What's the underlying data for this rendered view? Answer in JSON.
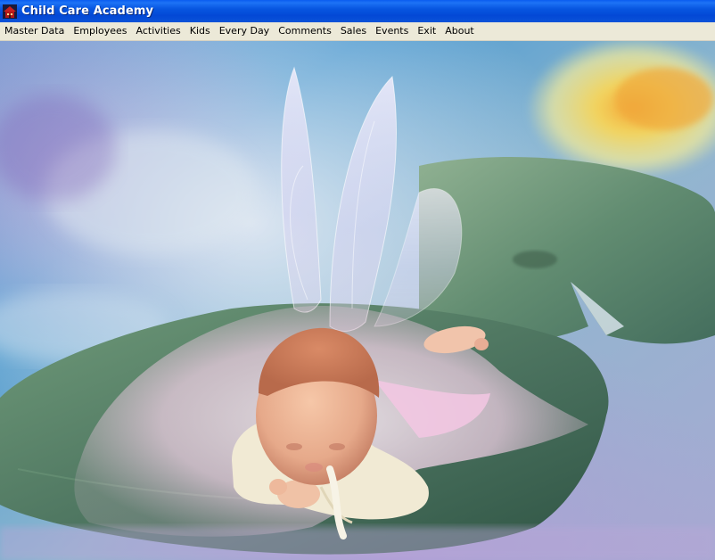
{
  "window": {
    "title": "Child Care Academy",
    "icon": "app-house-icon"
  },
  "menu": {
    "items": [
      {
        "key": "master-data",
        "label": "Master Data"
      },
      {
        "key": "employees",
        "label": "Employees"
      },
      {
        "key": "activities",
        "label": "Activities"
      },
      {
        "key": "kids",
        "label": "Kids"
      },
      {
        "key": "every-day",
        "label": "Every Day"
      },
      {
        "key": "comments",
        "label": "Comments"
      },
      {
        "key": "sales",
        "label": "Sales"
      },
      {
        "key": "events",
        "label": "Events"
      },
      {
        "key": "exit",
        "label": "Exit"
      },
      {
        "key": "about",
        "label": "About"
      }
    ]
  },
  "colors": {
    "titlebar": "#0756e0",
    "menubar": "#ece9d8",
    "lily_pad": "#4f7c62",
    "tutu": "#f3d6ea",
    "flower": "#f0d85a"
  }
}
